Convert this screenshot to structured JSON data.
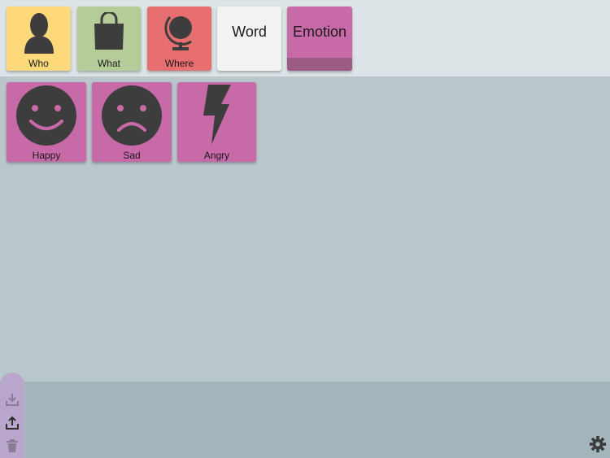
{
  "categories": [
    {
      "label": "Who",
      "icon": "person-icon",
      "color": "#fdd97b"
    },
    {
      "label": "What",
      "icon": "shopping-bag-icon",
      "color": "#b6cc98"
    },
    {
      "label": "Where",
      "icon": "globe-icon",
      "color": "#e76f6f"
    },
    {
      "label": "Word",
      "icon": "",
      "color": "#f2f2f2"
    },
    {
      "label": "Emotion",
      "icon": "",
      "color": "#c96aa8",
      "selected": true
    }
  ],
  "emotions": [
    {
      "label": "Happy",
      "icon": "happy-face-icon"
    },
    {
      "label": "Sad",
      "icon": "sad-face-icon"
    },
    {
      "label": "Angry",
      "icon": "lightning-bolt-icon"
    }
  ],
  "toolbar": {
    "icons": [
      "download-icon",
      "upload-icon",
      "trash-icon"
    ]
  },
  "settings_icon": "gear-icon",
  "colors": {
    "top_bar": "#dde4e7",
    "main_bg": "#b9c6cc",
    "bottom_panel": "#a4b6bc",
    "tab": "#b9a6cc",
    "icon_dark": "#3d3d3d"
  }
}
